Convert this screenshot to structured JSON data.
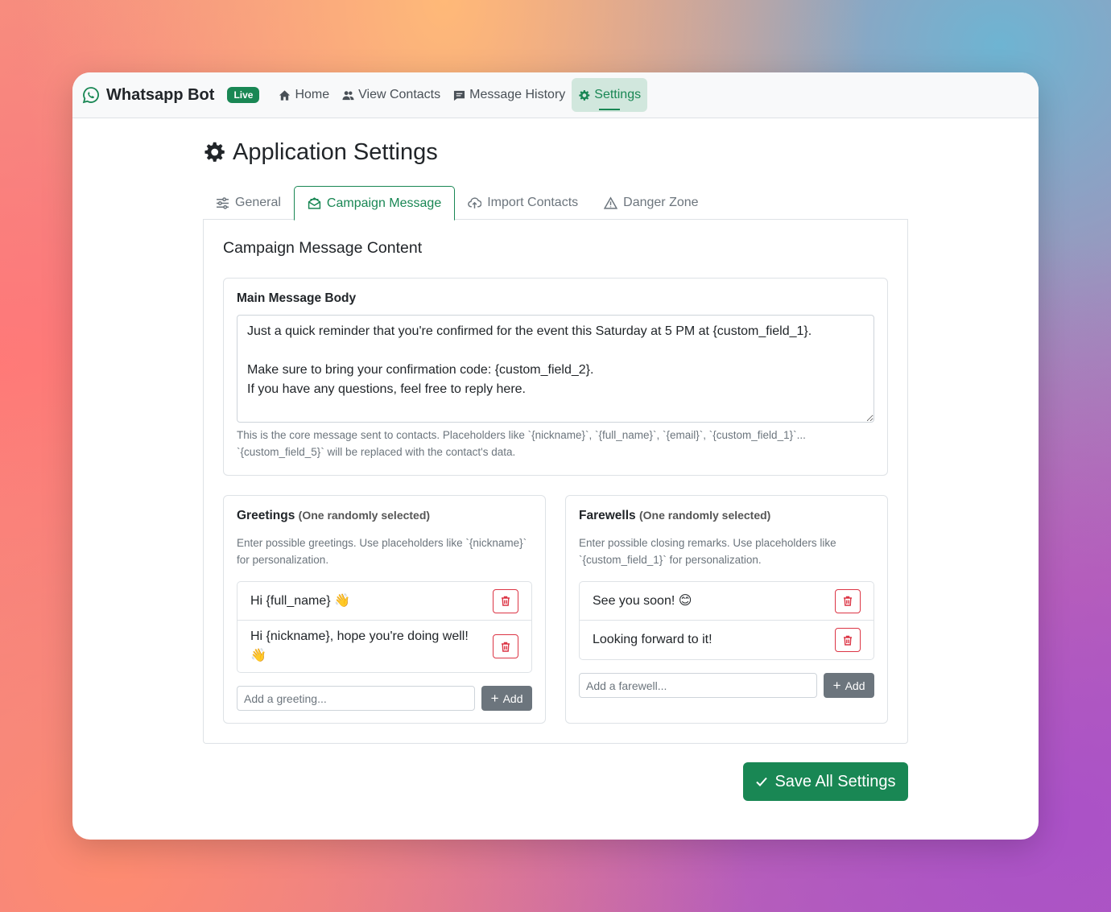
{
  "nav": {
    "brand": "Whatsapp Bot",
    "badge": "Live",
    "items": [
      {
        "label": "Home",
        "icon": "home-icon"
      },
      {
        "label": "View Contacts",
        "icon": "people-icon"
      },
      {
        "label": "Message History",
        "icon": "chat-icon"
      },
      {
        "label": "Settings",
        "icon": "gear-icon",
        "active": true
      }
    ]
  },
  "page": {
    "title": "Application Settings"
  },
  "tabs": [
    {
      "label": "General",
      "icon": "sliders-icon"
    },
    {
      "label": "Campaign Message",
      "icon": "envelope-open-icon",
      "active": true
    },
    {
      "label": "Import Contacts",
      "icon": "cloud-upload-icon"
    },
    {
      "label": "Danger Zone",
      "icon": "warning-icon"
    }
  ],
  "campaign": {
    "section_title": "Campaign Message Content",
    "main_body": {
      "label": "Main Message Body",
      "value": "Just a quick reminder that you're confirmed for the event this Saturday at 5 PM at {custom_field_1}.\n\nMake sure to bring your confirmation code: {custom_field_2}.\nIf you have any questions, feel free to reply here.",
      "help": "This is the core message sent to contacts. Placeholders like `{nickname}`, `{full_name}`, `{email}`, `{custom_field_1}`... `{custom_field_5}` will be replaced with the contact's data."
    },
    "greetings": {
      "label": "Greetings",
      "sub": "(One randomly selected)",
      "help": "Enter possible greetings. Use placeholders like `{nickname}` for personalization.",
      "items": [
        "Hi {full_name} 👋",
        "Hi {nickname}, hope you're doing well! 👋"
      ],
      "placeholder": "Add a greeting...",
      "add_label": "Add"
    },
    "farewells": {
      "label": "Farewells",
      "sub": "(One randomly selected)",
      "help": "Enter possible closing remarks. Use placeholders like `{custom_field_1}` for personalization.",
      "items": [
        "See you soon! 😊",
        "Looking forward to it!"
      ],
      "placeholder": "Add a farewell...",
      "add_label": "Add"
    }
  },
  "save_label": "Save All Settings",
  "colors": {
    "primary": "#198754",
    "danger": "#dc3545",
    "secondary": "#6c757d"
  }
}
